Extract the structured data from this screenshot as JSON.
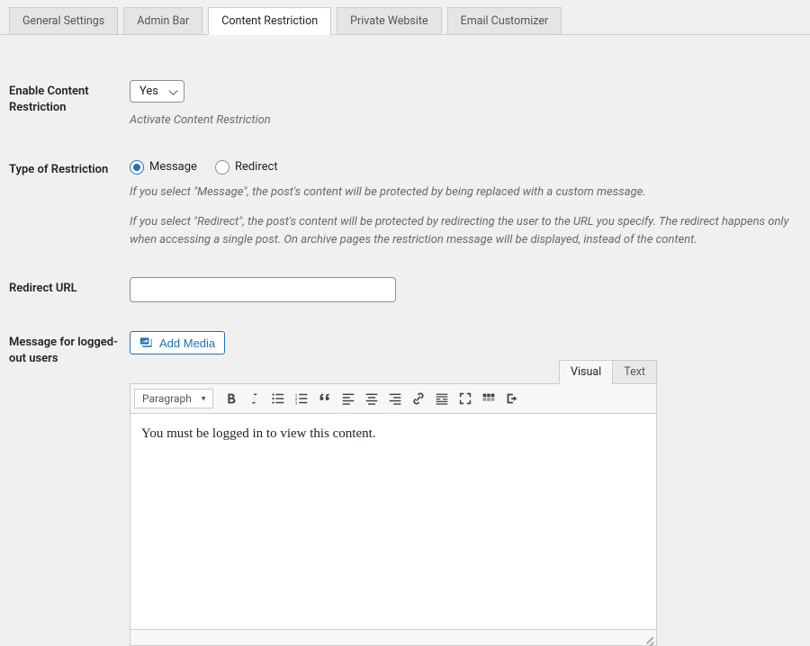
{
  "tabs": {
    "general": "General Settings",
    "admin_bar": "Admin Bar",
    "content_restriction": "Content Restriction",
    "private_website": "Private Website",
    "email_customizer": "Email Customizer"
  },
  "enable": {
    "label": "Enable Content Restriction",
    "value": "Yes",
    "help": "Activate Content Restriction"
  },
  "restriction_type": {
    "label": "Type of Restriction",
    "options": {
      "message": "Message",
      "redirect": "Redirect"
    },
    "selected": "message",
    "help1": "If you select \"Message\", the post's content will be protected by being replaced with a custom message.",
    "help2": "If you select \"Redirect\", the post's content will be protected by redirecting the user to the URL you specify. The redirect happens only when accessing a single post. On archive pages the restriction message will be displayed, instead of the content."
  },
  "redirect_url": {
    "label": "Redirect URL",
    "value": ""
  },
  "message": {
    "label": "Message for logged-out users",
    "add_media_label": "Add Media",
    "editor_tabs": {
      "visual": "Visual",
      "text": "Text"
    },
    "paragraph_label": "Paragraph",
    "content": "You must be logged in to view this content."
  }
}
